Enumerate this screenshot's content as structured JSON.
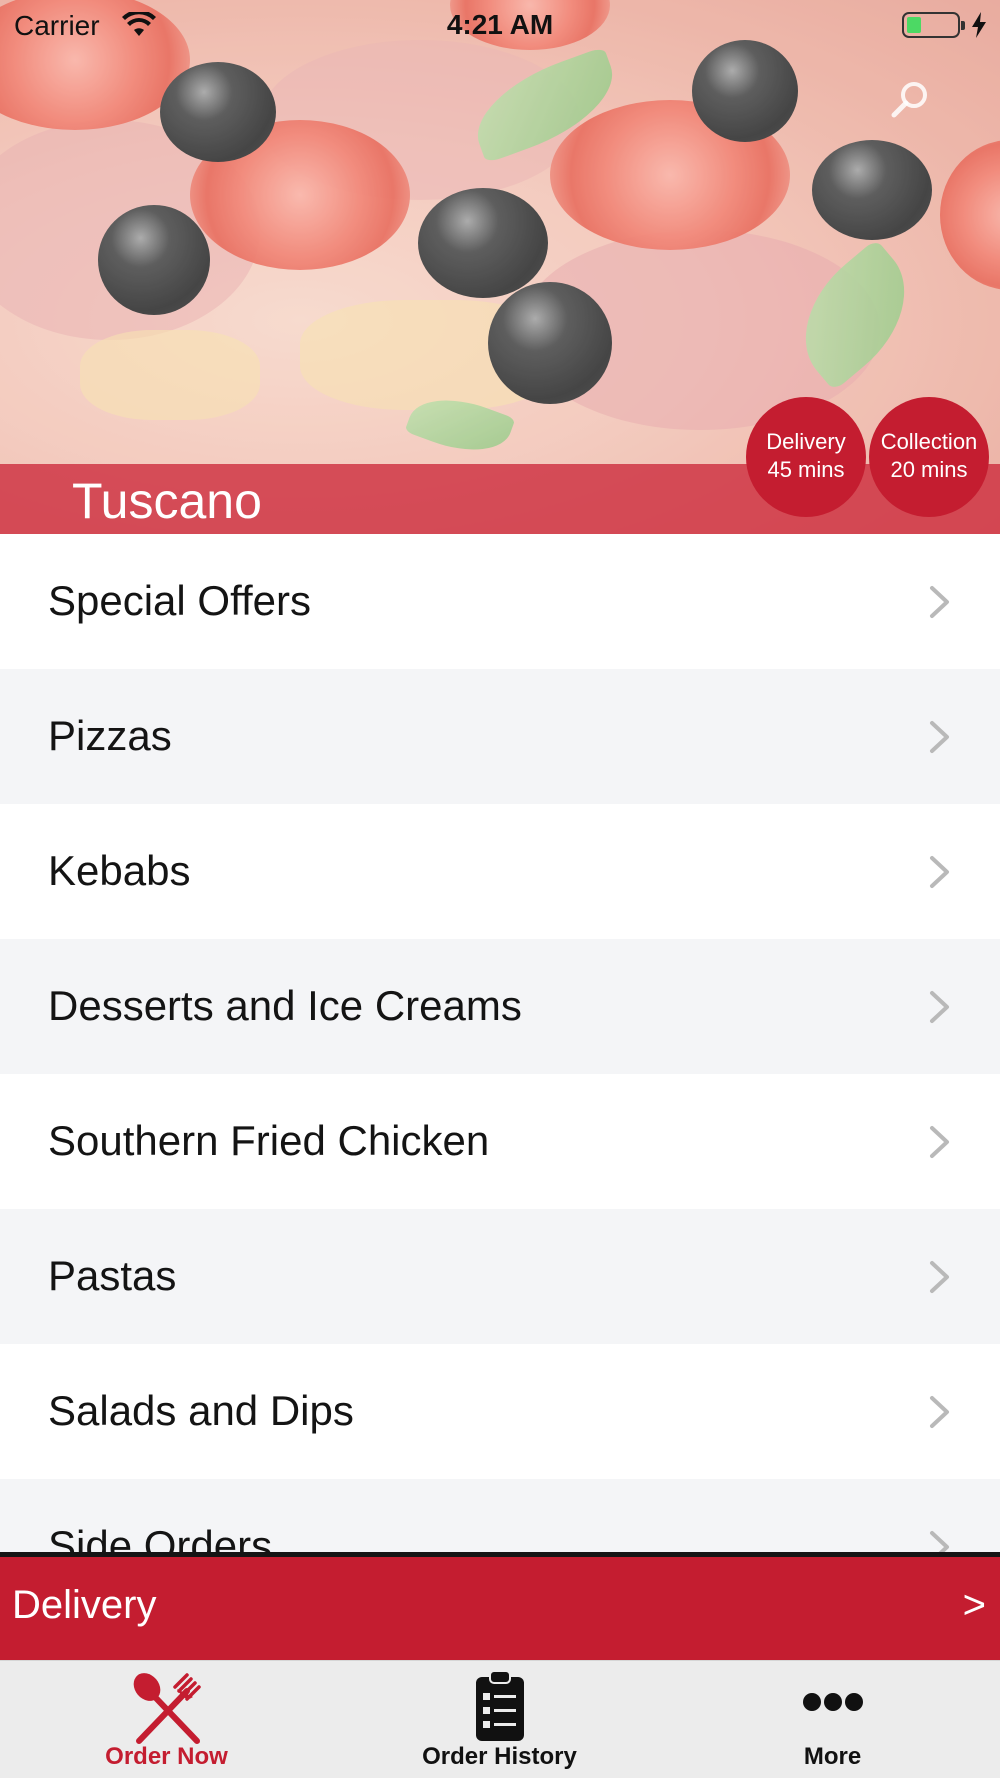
{
  "status_bar": {
    "carrier": "Carrier",
    "time": "4:21 AM",
    "wifi_icon": "wifi-icon",
    "battery_icon": "battery-icon",
    "charging_icon": "bolt-icon"
  },
  "header": {
    "restaurant_name": "Tuscano",
    "search_icon": "search-icon"
  },
  "badges": {
    "delivery": {
      "label": "Delivery",
      "time": "45 mins"
    },
    "collection": {
      "label": "Collection",
      "time": "20 mins"
    }
  },
  "menu": {
    "items": [
      {
        "label": "Special Offers"
      },
      {
        "label": "Pizzas"
      },
      {
        "label": "Kebabs"
      },
      {
        "label": "Desserts and Ice Creams"
      },
      {
        "label": "Southern Fried Chicken"
      },
      {
        "label": "Pastas"
      },
      {
        "label": "Salads and Dips"
      },
      {
        "label": "Side Orders"
      }
    ]
  },
  "order_mode": {
    "label": "Delivery",
    "arrow": ">"
  },
  "tabs": [
    {
      "label": "Order Now",
      "icon": "cutlery-icon",
      "active": true
    },
    {
      "label": "Order History",
      "icon": "clipboard-icon",
      "active": false
    },
    {
      "label": "More",
      "icon": "more-dots-icon",
      "active": false
    }
  ],
  "colors": {
    "brand_red": "#c41d30",
    "row_alt": "#f4f5f7",
    "tab_bar": "#ececec"
  }
}
